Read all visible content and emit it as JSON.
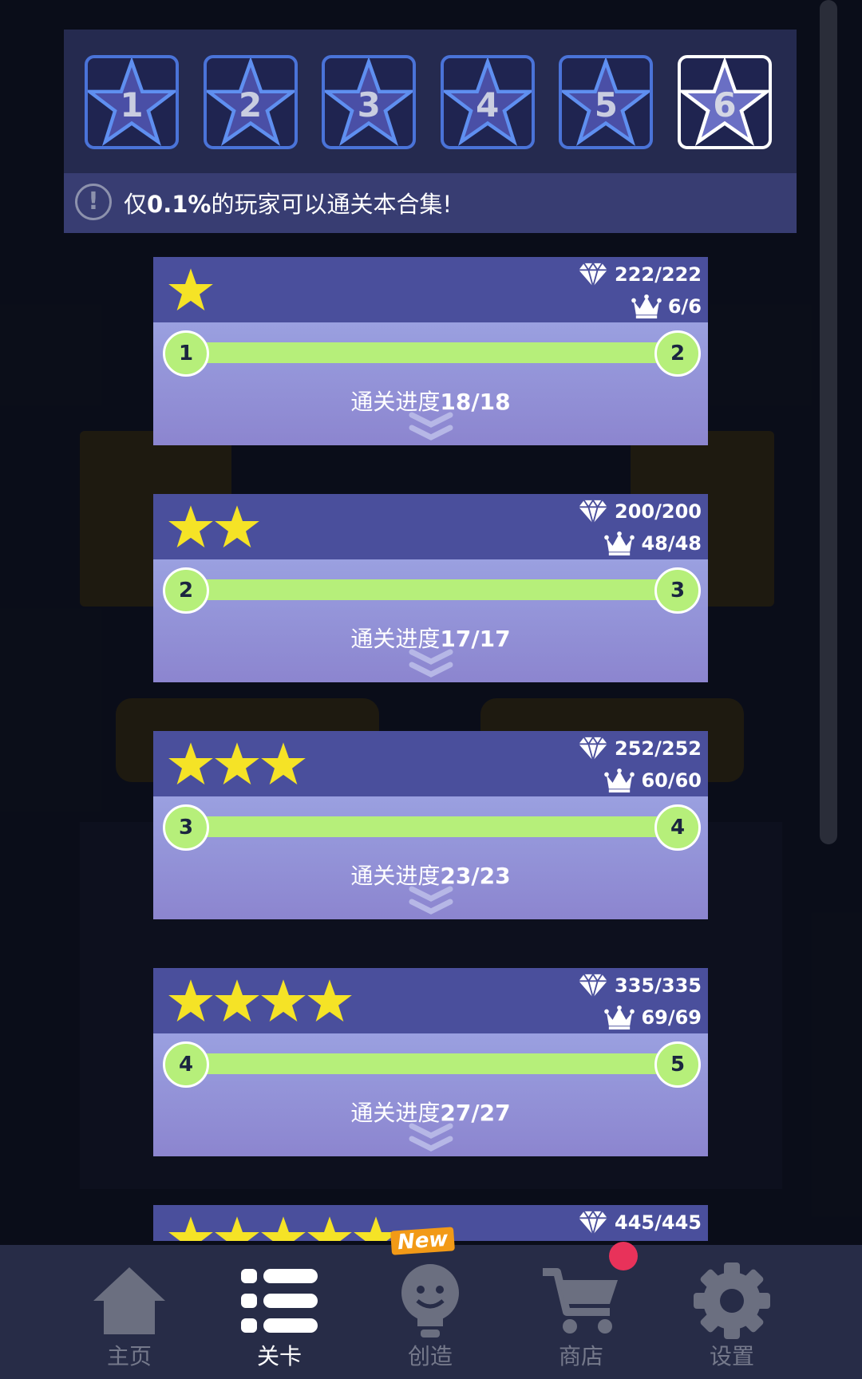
{
  "level_selector": {
    "levels": [
      "1",
      "2",
      "3",
      "4",
      "5",
      "6"
    ],
    "selected": "6"
  },
  "notice": {
    "prefix": "仅",
    "highlight": "0.1%",
    "suffix": "的玩家可以通关本合集!"
  },
  "cards": [
    {
      "stars": 1,
      "gems": "222/222",
      "crowns": "6/6",
      "start": "1",
      "end": "2",
      "progress_label": "通关进度",
      "progress_value": "18/18"
    },
    {
      "stars": 2,
      "gems": "200/200",
      "crowns": "48/48",
      "start": "2",
      "end": "3",
      "progress_label": "通关进度",
      "progress_value": "17/17"
    },
    {
      "stars": 3,
      "gems": "252/252",
      "crowns": "60/60",
      "start": "3",
      "end": "4",
      "progress_label": "通关进度",
      "progress_value": "23/23"
    },
    {
      "stars": 4,
      "gems": "335/335",
      "crowns": "69/69",
      "start": "4",
      "end": "5",
      "progress_label": "通关进度",
      "progress_value": "27/27"
    },
    {
      "stars": 5,
      "gems": "445/445"
    }
  ],
  "bottom_nav": {
    "items": [
      {
        "label": "主页",
        "icon": "home-icon"
      },
      {
        "label": "关卡",
        "icon": "list-icon",
        "active": true
      },
      {
        "label": "创造",
        "icon": "lightbulb-icon"
      },
      {
        "label": "商店",
        "icon": "cart-icon"
      },
      {
        "label": "设置",
        "icon": "gear-icon"
      }
    ],
    "new_badge": "New"
  },
  "colors": {
    "panel": "#252a4f",
    "card_head": "#4a4f9c",
    "track": "#b6ef7a",
    "star": "#f5e326",
    "selected_border": "#ffffff",
    "level_border": "#4a73d8"
  }
}
